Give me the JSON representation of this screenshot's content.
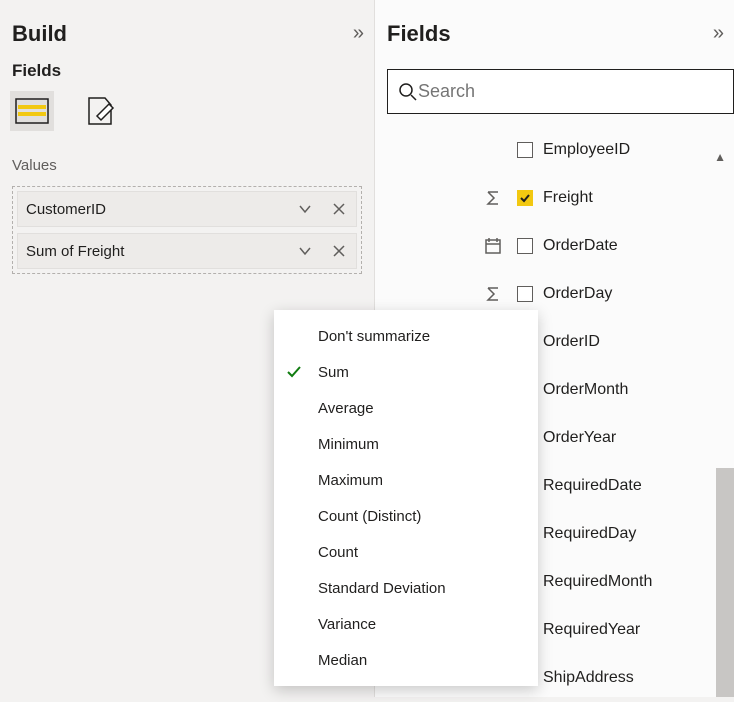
{
  "build_panel": {
    "title": "Build",
    "sub_title": "Fields",
    "values_label": "Values",
    "wells": [
      {
        "label": "CustomerID"
      },
      {
        "label": "Sum of Freight"
      }
    ]
  },
  "fields_panel": {
    "title": "Fields",
    "search_placeholder": "Search",
    "items": [
      {
        "name": "EmployeeID",
        "icon": "",
        "checked": false
      },
      {
        "name": "Freight",
        "icon": "sigma",
        "checked": true
      },
      {
        "name": "OrderDate",
        "icon": "calendar",
        "checked": false
      },
      {
        "name": "OrderDay",
        "icon": "sigma",
        "checked": false
      },
      {
        "name": "OrderID",
        "icon": "",
        "checked": false
      },
      {
        "name": "OrderMonth",
        "icon": "",
        "checked": false
      },
      {
        "name": "OrderYear",
        "icon": "",
        "checked": false
      },
      {
        "name": "RequiredDate",
        "icon": "",
        "checked": false
      },
      {
        "name": "RequiredDay",
        "icon": "",
        "checked": false
      },
      {
        "name": "RequiredMonth",
        "icon": "",
        "checked": false
      },
      {
        "name": "RequiredYear",
        "icon": "",
        "checked": false
      },
      {
        "name": "ShipAddress",
        "icon": "",
        "checked": false
      }
    ]
  },
  "context_menu": {
    "items": [
      {
        "label": "Don't summarize",
        "selected": false
      },
      {
        "label": "Sum",
        "selected": true
      },
      {
        "label": "Average",
        "selected": false
      },
      {
        "label": "Minimum",
        "selected": false
      },
      {
        "label": "Maximum",
        "selected": false
      },
      {
        "label": "Count (Distinct)",
        "selected": false
      },
      {
        "label": "Count",
        "selected": false
      },
      {
        "label": "Standard Deviation",
        "selected": false
      },
      {
        "label": "Variance",
        "selected": false
      },
      {
        "label": "Median",
        "selected": false
      }
    ]
  }
}
